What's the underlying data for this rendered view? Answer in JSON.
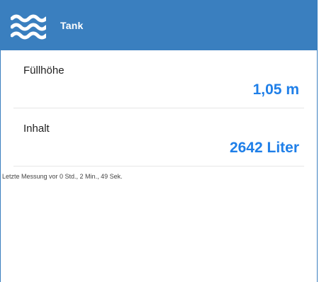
{
  "header": {
    "title": "Tank",
    "icon": "water-waves-icon",
    "background": "#3a7fbf"
  },
  "rows": [
    {
      "label": "Füllhöhe",
      "value": "1,05 m"
    },
    {
      "label": "Inhalt",
      "value": "2642 Liter"
    }
  ],
  "footer": {
    "text": "Letzte Messung vor 0 Std., 2 Min., 49 Sek."
  },
  "colors": {
    "accent": "#1f7fe8",
    "divider": "#e6e6e6"
  }
}
